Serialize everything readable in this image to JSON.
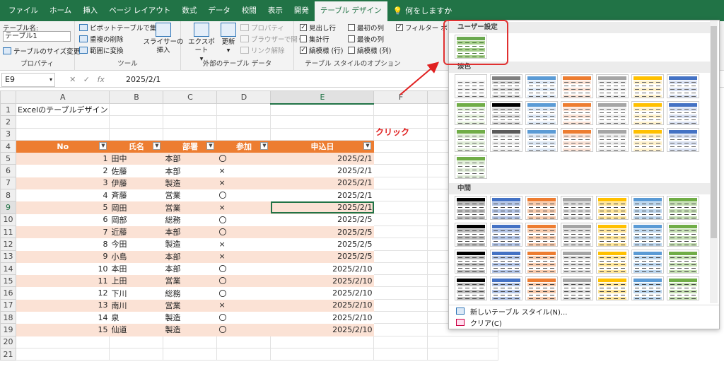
{
  "tabs": [
    "ファイル",
    "ホーム",
    "挿入",
    "ページ レイアウト",
    "数式",
    "データ",
    "校閲",
    "表示",
    "開発",
    "テーブル デザイン"
  ],
  "tell_me": "何をしますか",
  "ribbon": {
    "prop_label": "テーブル名:",
    "table_name": "テーブル1",
    "resize": "テーブルのサイズ変更",
    "prop_group": "プロパティ",
    "pivot": "ピボットテーブルで集計",
    "dedupe": "重複の削除",
    "convert": "範囲に変換",
    "slicer": "スライサーの\n挿入",
    "tools_group": "ツール",
    "export": "エクスポート",
    "refresh": "更新",
    "props": "プロパティ",
    "browser": "ブラウザーで開く",
    "unlink": "リンク解除",
    "ext_group": "外部のテーブル データ",
    "opt_header": "見出し行",
    "opt_total": "集計行",
    "opt_banded_rows": "縞模様 (行)",
    "opt_first_col": "最初の列",
    "opt_last_col": "最後の列",
    "opt_banded_cols": "縞模様 (列)",
    "opt_filter": "フィルター ボタン",
    "opt_group": "テーブル スタイルのオプション"
  },
  "formula": {
    "namebox": "E9",
    "cancel": "✕",
    "enter": "✓",
    "fx": "fx",
    "value": "2025/2/1"
  },
  "columns": [
    "A",
    "B",
    "C",
    "D",
    "E",
    "F",
    "G"
  ],
  "cell_a1": "Excelのテーブルデザイン",
  "table_headers": [
    "No",
    "氏名",
    "部署",
    "参加",
    "申込日"
  ],
  "rows": [
    [
      "1",
      "田中",
      "本部",
      "〇",
      "2025/2/1"
    ],
    [
      "2",
      "佐藤",
      "本部",
      "×",
      "2025/2/1"
    ],
    [
      "3",
      "伊藤",
      "製造",
      "×",
      "2025/2/1"
    ],
    [
      "4",
      "斉藤",
      "営業",
      "〇",
      "2025/2/1"
    ],
    [
      "5",
      "岡田",
      "営業",
      "×",
      "2025/2/1"
    ],
    [
      "6",
      "岡部",
      "総務",
      "〇",
      "2025/2/5"
    ],
    [
      "7",
      "近藤",
      "本部",
      "〇",
      "2025/2/5"
    ],
    [
      "8",
      "今田",
      "製造",
      "×",
      "2025/2/5"
    ],
    [
      "9",
      "小島",
      "本部",
      "×",
      "2025/2/5"
    ],
    [
      "10",
      "本田",
      "本部",
      "〇",
      "2025/2/10"
    ],
    [
      "11",
      "上田",
      "営業",
      "〇",
      "2025/2/10"
    ],
    [
      "12",
      "下川",
      "総務",
      "〇",
      "2025/2/10"
    ],
    [
      "13",
      "南川",
      "営業",
      "×",
      "2025/2/10"
    ],
    [
      "14",
      "泉",
      "製造",
      "〇",
      "2025/2/10"
    ],
    [
      "15",
      "仙道",
      "製造",
      "〇",
      "2025/2/10"
    ]
  ],
  "click_note": "クリック",
  "gallery": {
    "user_section": "ユーザー設定",
    "light_section": "淡色",
    "medium_section": "中間",
    "new_style": "新しいテーブル スタイル(N)...",
    "clear": "クリア(C)"
  },
  "colors": {
    "accent": "#217346",
    "table_header": "#ed7d31",
    "table_band": "#fbe2d5",
    "annotation": "#e02020"
  }
}
